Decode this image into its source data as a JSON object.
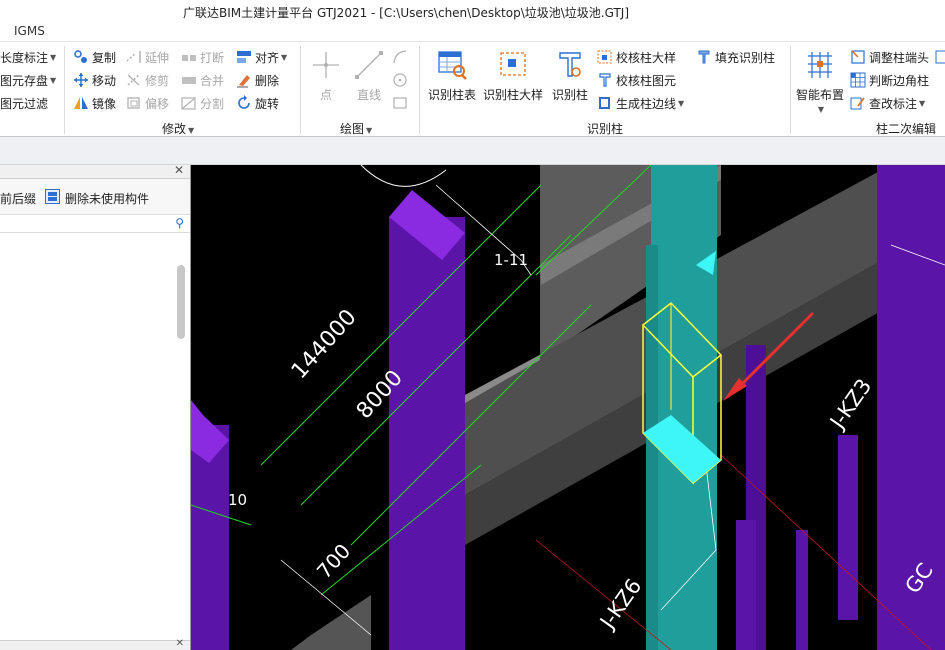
{
  "window": {
    "title": "广联达BIM土建计量平台 GTJ2021 - [C:\\Users\\chen\\Desktop\\垃圾池\\垃圾池.GTJ]"
  },
  "ribbon_tab": "IGMS",
  "ribbon": {
    "left_partial": {
      "items": [
        "长度标注",
        "图元存盘",
        "图元过滤"
      ]
    },
    "modify": {
      "title": "修改",
      "col1": [
        "复制",
        "移动",
        "镜像"
      ],
      "col2": [
        "延伸",
        "修剪",
        "偏移"
      ],
      "col3": [
        "打断",
        "合并",
        "分割"
      ],
      "col4": [
        "对齐",
        "删除",
        "旋转"
      ]
    },
    "draw": {
      "title": "绘图",
      "point": "点",
      "line": "直线"
    },
    "identify": {
      "title": "识别柱",
      "big": [
        "识别柱表",
        "识别柱大样",
        "识别柱"
      ],
      "small": [
        "校核柱大样",
        "校核柱图元",
        "生成柱边线",
        "填充识别柱"
      ]
    },
    "column_edit": {
      "title": "柱二次编辑",
      "big": "智能布置",
      "small": [
        "调整柱端头",
        "判断边角柱",
        "查改标注"
      ]
    }
  },
  "left_panel": {
    "tools": [
      "前后缀",
      "删除未使用构件"
    ]
  },
  "viewport": {
    "labels": [
      "144000",
      "8000",
      "1-11",
      "10",
      "700",
      "J-KZ6",
      "J-KZ3",
      "GC"
    ]
  },
  "colors": {
    "viewport_bg": "#000000",
    "column_purple": "#5a14a8",
    "column_purple_top": "#8a2be2",
    "column_teal": "#1f9e9c",
    "highlight_cyan": "#3ff6f6",
    "wall_grey": "#5c5c5c",
    "dim_green": "#1ed81e",
    "selection_yellow": "#ffff3a",
    "arrow_red": "#e53030"
  }
}
